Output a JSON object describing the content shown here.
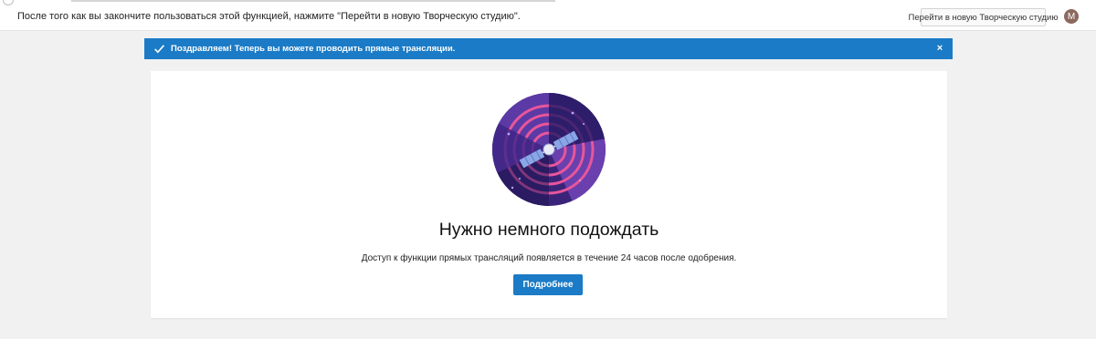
{
  "topbar": {
    "message": "После того как вы закончите пользоваться этой функцией, нажмите \"Перейти в новую Творческую студию\".",
    "studio_button_label": "Перейти в новую Творческую студию",
    "avatar_initial": "M"
  },
  "banner": {
    "message": "Поздравляем! Теперь вы можете проводить прямые трансляции.",
    "close_symbol": "×",
    "color": "#1b7bc6"
  },
  "main": {
    "illustration": "satellite-illustration",
    "heading": "Нужно немного подождать",
    "description": "Доступ к функции прямых трансляций появляется в течение 24 часов после одобрения.",
    "more_button_label": "Подробнее"
  },
  "colors": {
    "accent": "#1b7bc6",
    "page_background": "#f1f1f1",
    "illustration_purple": "#4a2c8f",
    "illustration_rings": "#e8569a"
  }
}
